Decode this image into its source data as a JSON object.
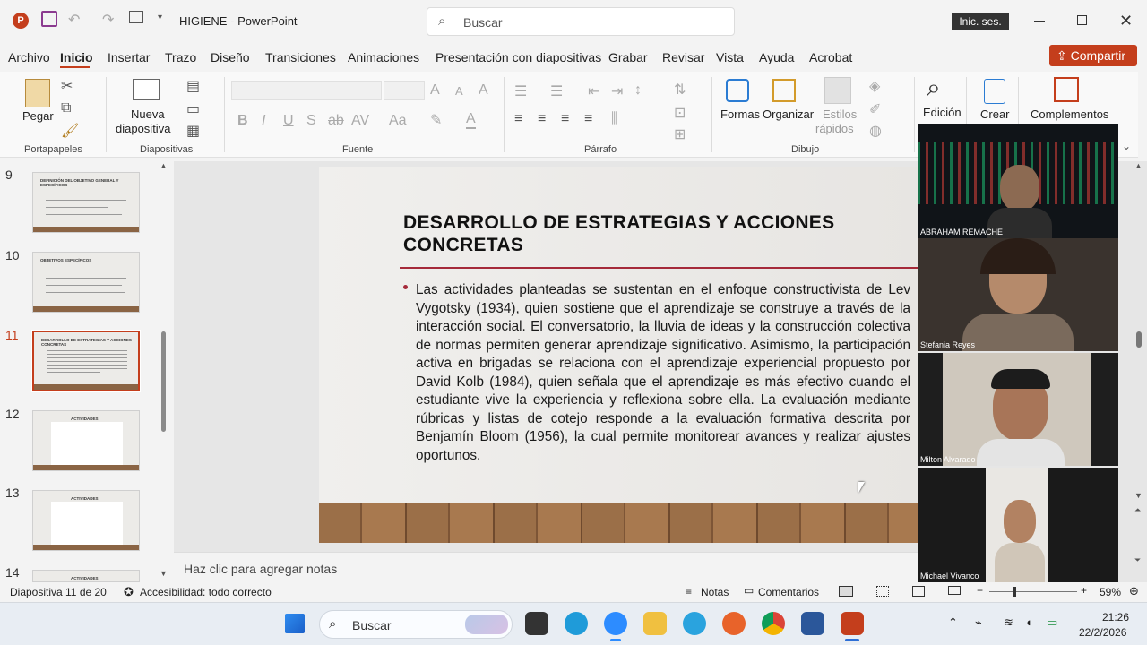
{
  "titlebar": {
    "autosave": "",
    "filename": "HIGIENE",
    "app": "PowerPoint",
    "separator": "-",
    "search_placeholder": "Buscar",
    "signin": "Inic. ses."
  },
  "menu": [
    "Archivo",
    "Inicio",
    "Insertar",
    "Trazo",
    "Diseño",
    "Transiciones",
    "Animaciones",
    "Presentación con diapositivas",
    "Grabar",
    "Revisar",
    "Vista",
    "Ayuda",
    "Acrobat"
  ],
  "share_label": "Compartir",
  "ribbon": {
    "paste": "Pegar",
    "new_slide": "Nueva",
    "new_slide2": "diapositiva",
    "shapes": "Formas",
    "arrange": "Organizar",
    "styles": "Estilos",
    "styles2": "rápidos",
    "edit": "Edición",
    "create": "Crear",
    "addins": "Complementos",
    "groups": {
      "clipboard": "Portapapeles",
      "slides": "Diapositivas",
      "font": "Fuente",
      "paragraph": "Párrafo",
      "drawing": "Dibujo"
    }
  },
  "thumbs": [
    {
      "num": "9",
      "title": "DEFINICIÓN DEL OBJETIVO GENERAL Y ESPECÍFICOS"
    },
    {
      "num": "10",
      "title": "OBJETIVOS ESPECÍFICOS"
    },
    {
      "num": "11",
      "title": "DESARROLLO DE ESTRATEGIAS Y ACCIONES CONCRETAS"
    },
    {
      "num": "12",
      "title": "ACTIVIDADES"
    },
    {
      "num": "13",
      "title": "ACTIVIDADES"
    },
    {
      "num": "14",
      "title": "ACTIVIDADES"
    }
  ],
  "slide": {
    "title": "DESARROLLO DE ESTRATEGIAS Y ACCIONES CONCRETAS",
    "body": "Las actividades planteadas se sustentan en el enfoque constructivista de Lev Vygotsky (1934), quien sostiene que el aprendizaje se construye a través de la interacción social. El conversatorio, la lluvia de ideas y la construcción colectiva de normas permiten generar aprendizaje significativo. Asimismo, la participación activa en brigadas se relaciona con el aprendizaje experiencial propuesto por David Kolb (1984), quien señala que el aprendizaje es más efectivo cuando el estudiante vive la experiencia y reflexiona sobre ella. La evaluación mediante rúbricas y listas de cotejo responde a la evaluación formativa descrita por Benjamín Bloom (1956), la cual permite monitorear avances y realizar ajustes oportunos."
  },
  "notes_placeholder": "Haz clic para agregar notas",
  "participants": [
    "ABRAHAM REMACHE",
    "Stefania Reyes",
    "Milton Alvarado",
    "Michael Vivanco"
  ],
  "status": {
    "slide": "Diapositiva 11 de 20",
    "accessibility": "Accesibilidad: todo correcto",
    "notes": "Notas",
    "comments": "Comentarios",
    "zoom": "59%"
  },
  "taskbar": {
    "search": "Buscar",
    "time": "21:26",
    "date": "22/2/2026"
  }
}
